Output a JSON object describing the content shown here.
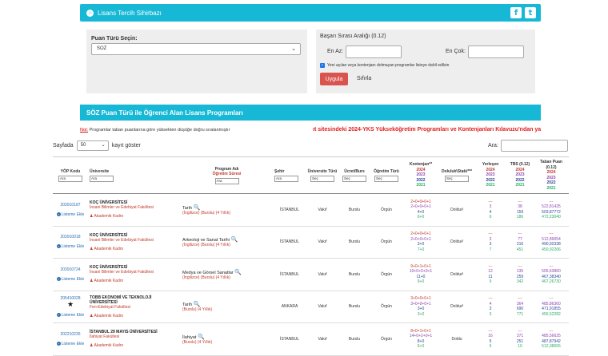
{
  "header": {
    "title": "Lisans Tercih Sihirbazı",
    "social": [
      "f",
      "t"
    ]
  },
  "score_type": {
    "label": "Puan Türü Seçin:",
    "value": "SOZ"
  },
  "rank": {
    "label": "Başarı Sırası Aralığı (0.12)",
    "min_label": "En Az:",
    "max_label": "En Çok:",
    "checkbox_label": "Yeni açılan veya kontenjanı dolmayan programlar listeye dahil edilsin",
    "apply": "Uygula",
    "reset": "Sıfırla"
  },
  "section_title": "SÖZ Puan Türü ile Öğrenci Alan Lisans Programları",
  "note_prefix": "Not:",
  "note_text": " Programlar taban puanlarına göre yüksekten düşüğe doğru sıralanmıştır",
  "marquee": "ıt sitesindeki 2024-YKS Yükseköğretim Programları ve Kontenjanları Kılavuzu'ndan ya",
  "pager": {
    "before": "Sayfada",
    "value": "50",
    "after": "kayıt göster"
  },
  "search_label": "Ara:",
  "columns": {
    "yop": "YÖP Kodu",
    "uni": "Üniversite",
    "prog1": "Program Adı",
    "prog2": "Öğretim Süresi",
    "city": "Şehir",
    "uni_type": "Üniversite Türü",
    "fee": "Ücret/Burs",
    "edu": "Öğretim Türü",
    "kont": "Kontenjan**",
    "doluluk": "Doluluk\\Statü***",
    "yerlesen": "Yerleşen",
    "tbs": "TBS (0.12)",
    "taban": "Taban Puan",
    "taban_sub": "(0.12)",
    "ara": "Ara",
    "sec": "Seç",
    "years": [
      "2024",
      "2023",
      "2022",
      "2021"
    ]
  },
  "rows": [
    {
      "code": "203910187",
      "star": "",
      "ekle": "Listeme Ekle",
      "uni": "KOÇ ÜNİVERSİTESİ",
      "fac": "İnsani Bilimler ve Edebiyat Fakültesi",
      "kadro": "Akademik Kadro",
      "prog": "Tarih",
      "det": "(İngilizce) (Burslu) (4 Yıllık)",
      "city": "İSTANBUL",
      "type": "Vakıf",
      "fee": "Burslu",
      "edu": "Örgün",
      "kont": [
        "2+0+0+0+1",
        "2+0+0+0+1",
        "4+0",
        "6+0"
      ],
      "dol": "Doldu#",
      "yer": [
        "---",
        "3",
        "4",
        "6"
      ],
      "tbs": [
        "---",
        "38",
        "159",
        "186"
      ],
      "taban": [
        "---",
        "522,81425",
        "503,87772",
        "472,23040"
      ]
    },
    {
      "code": "203910018",
      "star": "",
      "ekle": "Listeme Ekle",
      "uni": "KOÇ ÜNİVERSİTESİ",
      "fac": "İnsani Bilimler ve Edebiyat Fakültesi",
      "kadro": "Akademik Kadro",
      "prog": "Arkeoloji ve Sanat Tarihi",
      "det": "(İngilizce) (Burslu) (4 Yıllık)",
      "city": "İSTANBUL",
      "type": "Vakıf",
      "fee": "Burslu",
      "edu": "Örgün",
      "kont": [
        "2+0+0+0+1",
        "2+0+0+0+1",
        "3+0",
        "7+0"
      ],
      "dol": "Doldu#",
      "yer": [
        "---",
        "3",
        "3",
        "7"
      ],
      "tbs": [
        "---",
        "77",
        "216",
        "451"
      ],
      "taban": [
        "---",
        "512,89654",
        "490,92338",
        "450,92266"
      ]
    },
    {
      "code": "203910724",
      "star": "",
      "ekle": "Listeme Ekle",
      "uni": "KOÇ ÜNİVERSİTESİ",
      "fac": "İnsani Bilimler ve Edebiyat Fakültesi",
      "kadro": "Akademik Kadro",
      "prog": "Medya ve Görsel Sanatlar",
      "det": "(İngilizce) (Burslu) (4 Yıllık)",
      "city": "İSTANBUL",
      "type": "Vakıf",
      "fee": "Burslu",
      "edu": "Örgün",
      "kont": [
        "9+0+1+0+1",
        "10+0+0+0+1",
        "11+0",
        "9+0"
      ],
      "dol": "Doldu#",
      "yer": [
        "---",
        "12",
        "11",
        "9"
      ],
      "tbs": [
        "---",
        "135",
        "259",
        "342"
      ],
      "taban": [
        "---",
        "505,63860",
        "467,38340",
        "467,26730"
      ]
    },
    {
      "code": "205410028",
      "star": "★",
      "ekle": "Listeme Ekle",
      "uni": "TOBB EKONOMİ VE TEKNOLOJİ ÜNİVERSİTESİ",
      "fac": "Fen-Edebiyat Fakültesi",
      "kadro": "Akademik Kadro",
      "prog": "Tarih",
      "det": "(Burslu) (4 Yıllık)",
      "city": "ANKARA",
      "type": "Vakıf",
      "fee": "Burslu",
      "edu": "Örgün",
      "kont": [
        "3+0+0+0+1",
        "3+0+0+0+1",
        "3+0",
        "3+0"
      ],
      "dol": "Doldu#",
      "yer": [
        "---",
        "4",
        "3",
        "3"
      ],
      "tbs": [
        "---",
        "364",
        "690",
        "771"
      ],
      "taban": [
        "---",
        "485,86360",
        "471,91855",
        "456,52282"
      ]
    },
    {
      "code": "202210226",
      "star": "",
      "ekle": "Listeme Ekle",
      "uni": "İSTANBUL 29 MAYIS ÜNİVERSİTESİ",
      "fac": "İlahiyat Fakültesi",
      "kadro": "Akademik Kadro",
      "prog": "İlahiyat",
      "det": "(Burslu) (4 Yıllık)",
      "city": "İSTANBUL",
      "type": "Vakıf",
      "fee": "Burslu",
      "edu": "Örgün",
      "kont": [
        "8+0+1+0+1",
        "14+0+2+0+1",
        "8+0",
        "6+0"
      ],
      "dol": "Doldu",
      "yer": [
        "---",
        "16",
        "5",
        "6"
      ],
      "tbs": [
        "---",
        "371",
        "251",
        "10"
      ],
      "taban": [
        "---",
        "485,56625",
        "487,87942",
        "512,38655"
      ]
    }
  ],
  "colors": {
    "brand": "#17b8d6",
    "apply": "#d9534f",
    "marquee": "#e02020"
  }
}
